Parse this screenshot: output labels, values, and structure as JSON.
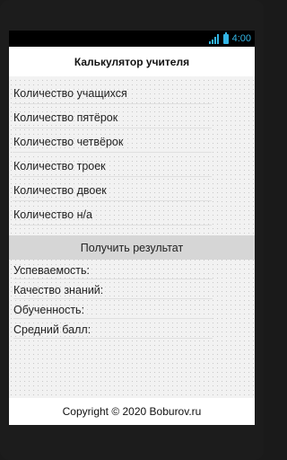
{
  "status_bar": {
    "time": "4:00"
  },
  "app": {
    "title": "Калькулятор учителя"
  },
  "inputs": [
    {
      "label": "Количество учащихся"
    },
    {
      "label": "Количество пятёрок"
    },
    {
      "label": "Количество четвёрок"
    },
    {
      "label": "Количество троек"
    },
    {
      "label": "Количество двоек"
    },
    {
      "label": "Количество н/а"
    }
  ],
  "result_button": {
    "label": "Получить результат"
  },
  "results": [
    {
      "label": "Успеваемость:"
    },
    {
      "label": "Качество знаний:"
    },
    {
      "label": "Обученность:"
    },
    {
      "label": "Средний балл:"
    }
  ],
  "footer": {
    "text": "Copyright © 2020 Boburov.ru"
  },
  "colors": {
    "status_accent": "#33b5e5",
    "button_bg": "#d6d6d6"
  }
}
